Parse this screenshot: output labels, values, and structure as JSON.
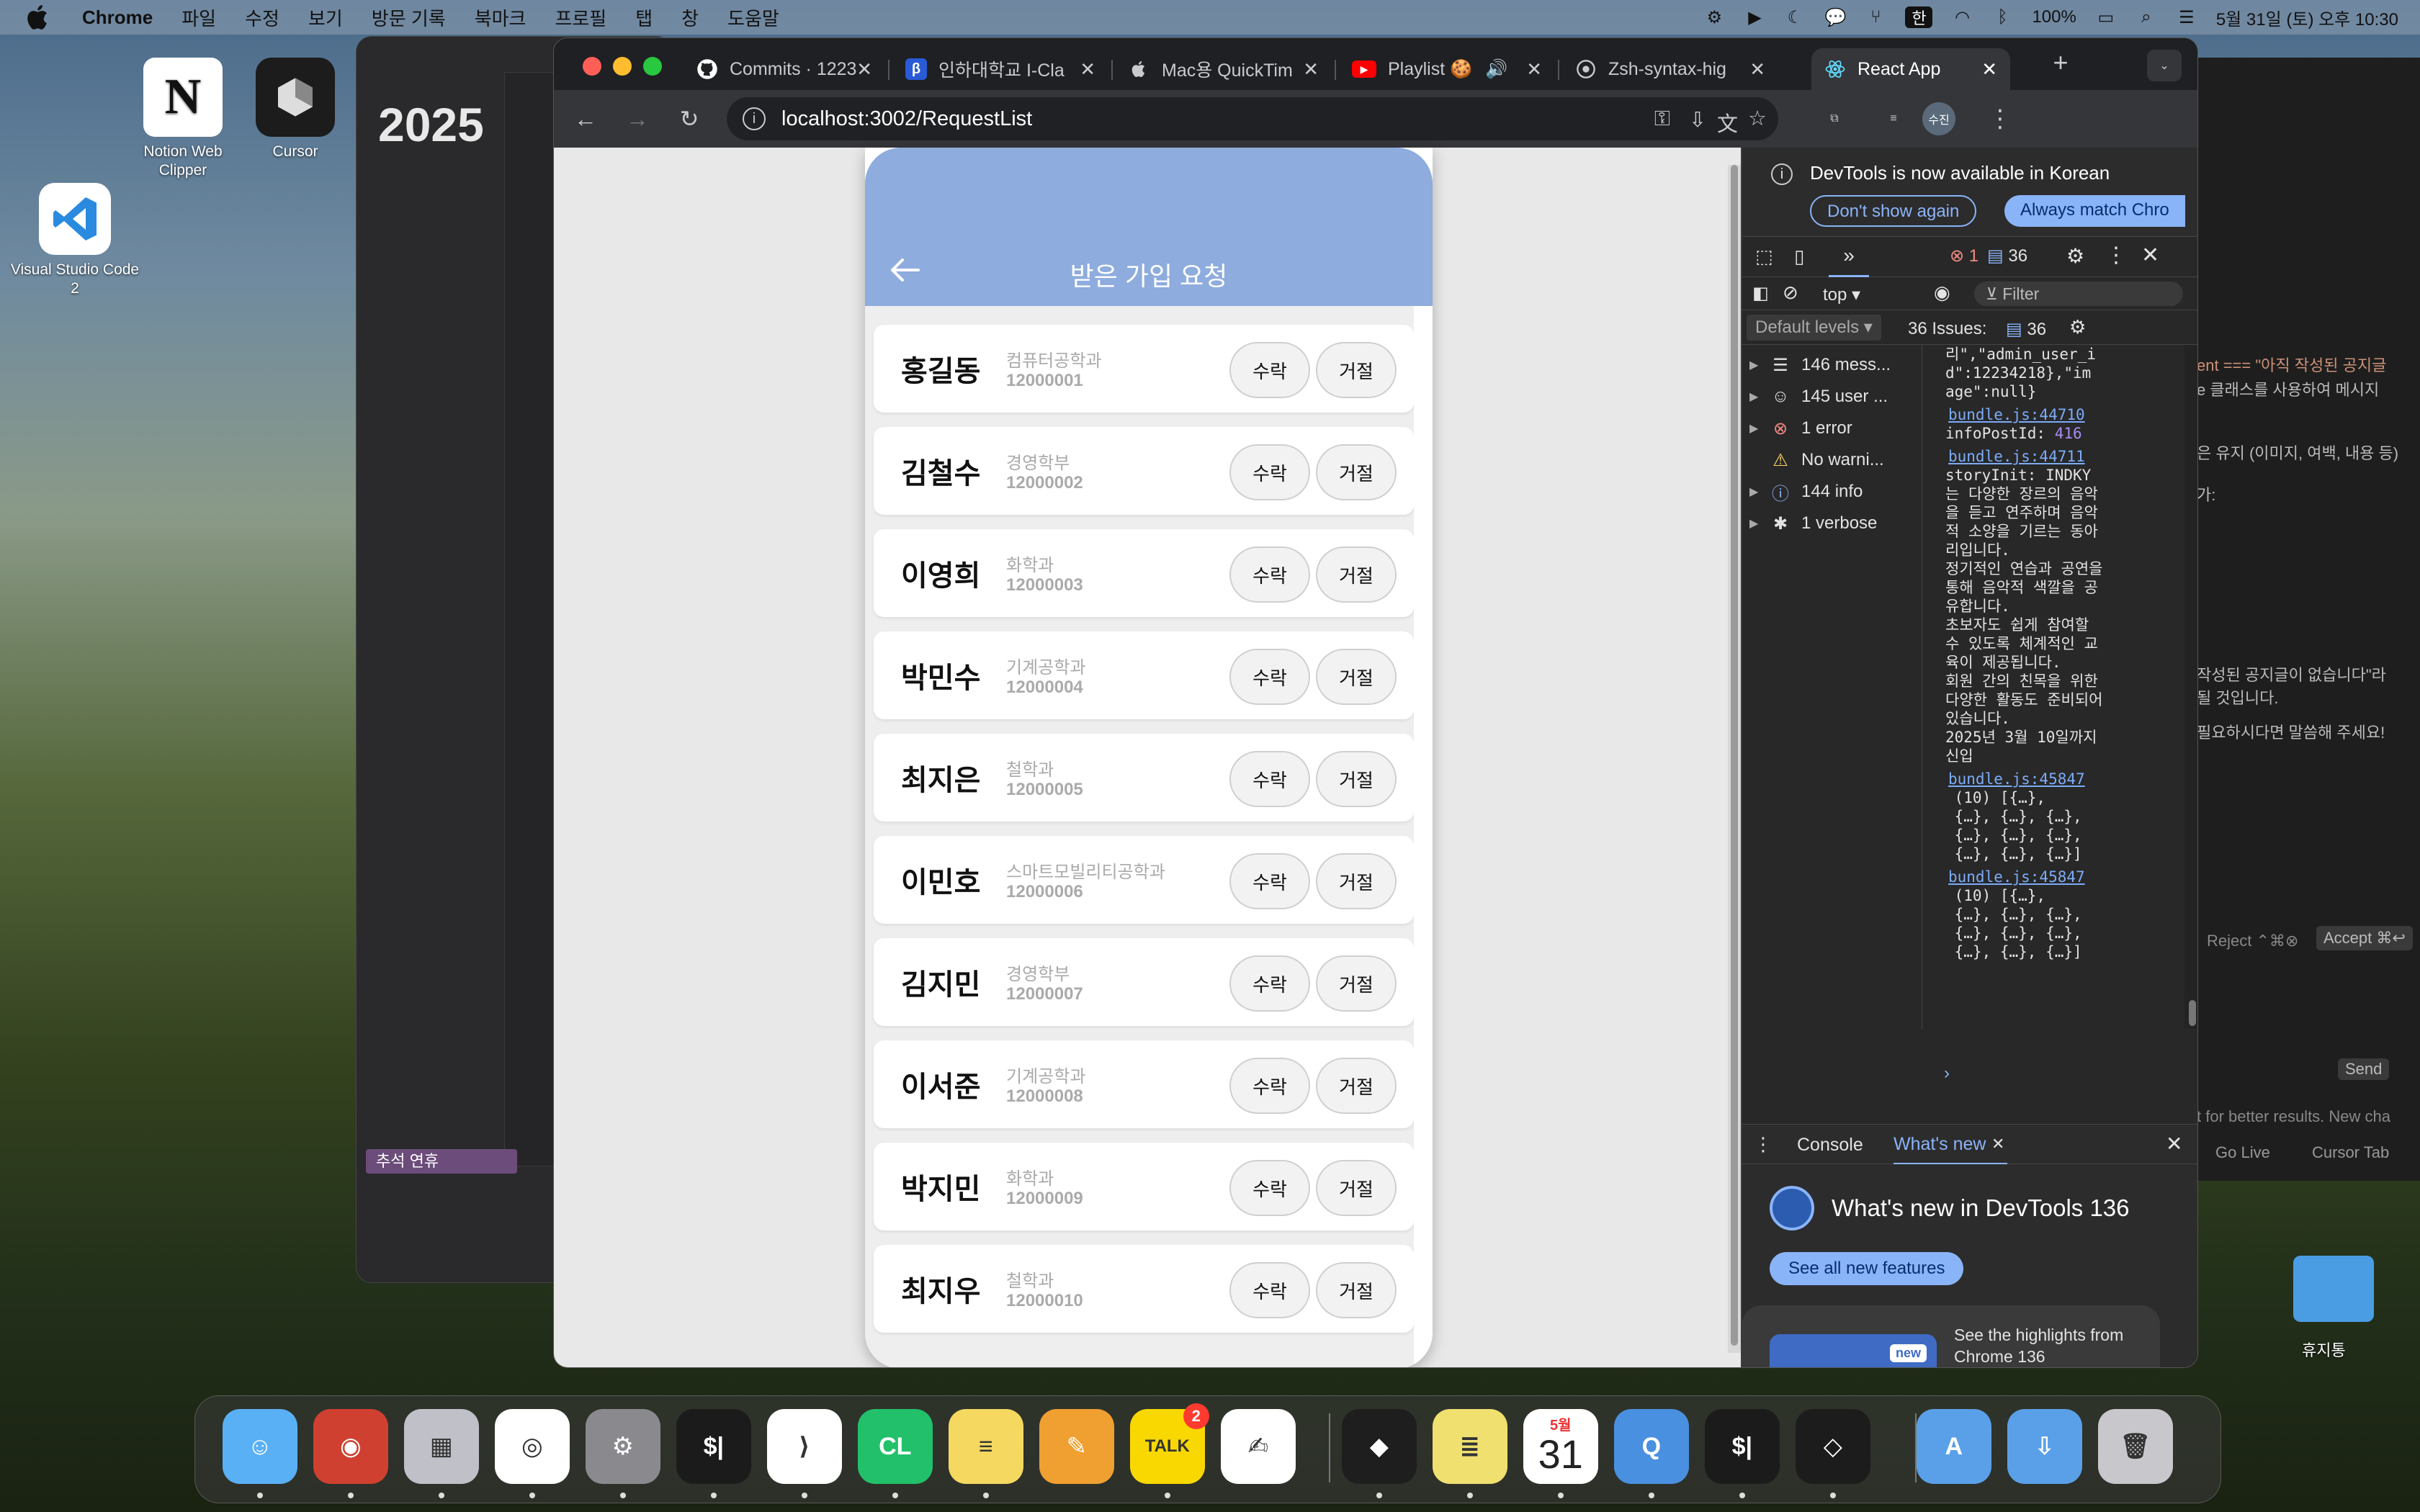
{
  "menubar": {
    "app": "Chrome",
    "menus": [
      "파일",
      "수정",
      "보기",
      "방문 기록",
      "북마크",
      "프로필",
      "탭",
      "창",
      "도움말"
    ],
    "battery": "100%",
    "input_lang": "한",
    "clock": "5월 31일 (토) 오후 10:30"
  },
  "desktop": {
    "icons": [
      {
        "label": "Notion Web Clipper",
        "icon": "notion-icon"
      },
      {
        "label": "Cursor",
        "icon": "cursor-icon"
      },
      {
        "label": "Visual Studio Code 2",
        "icon": "vscode-icon"
      }
    ],
    "trash_label": "휴지통"
  },
  "background_windows": {
    "title_fragment": "2025",
    "chip_label": "추석 연휴",
    "editor_lines": [
      "ent === \"아직 작성된 공지글",
      "e 클래스를 사용하여 메시지",
      "은 유지 (이미지, 여백, 내용 등)",
      "가:",
      "작성된 공지글이 없습니다\"라",
      "될 것입니다.",
      "필요하시다면 말씀해 주세요!",
      "Reject ⌃⌘⊗",
      "Accept ⌘↩",
      "Send",
      "t for better results.  New cha",
      "Go Live",
      "Cursor Tab"
    ]
  },
  "browser": {
    "tabs": [
      {
        "label": "Commits · 1223",
        "icon": "github-icon",
        "active": false
      },
      {
        "label": "인하대학교 I-Cla",
        "icon": "inha-icon",
        "active": false
      },
      {
        "label": "Mac용 QuickTim",
        "icon": "apple-icon",
        "active": false
      },
      {
        "label": "Playlist 🍪",
        "icon": "youtube-icon",
        "active": false
      },
      {
        "label": "Zsh-syntax-hig",
        "icon": "web-icon",
        "active": false
      },
      {
        "label": "React App",
        "icon": "react-icon",
        "active": true
      }
    ],
    "url": "localhost:3002/RequestList",
    "profile_badge": "수진"
  },
  "app": {
    "title": "받은 가입 요청",
    "accept_label": "수락",
    "reject_label": "거절",
    "requests": [
      {
        "name": "홍길동",
        "dept": "컴퓨터공학과",
        "id": "12000001"
      },
      {
        "name": "김철수",
        "dept": "경영학부",
        "id": "12000002"
      },
      {
        "name": "이영희",
        "dept": "화학과",
        "id": "12000003"
      },
      {
        "name": "박민수",
        "dept": "기계공학과",
        "id": "12000004"
      },
      {
        "name": "최지은",
        "dept": "철학과",
        "id": "12000005"
      },
      {
        "name": "이민호",
        "dept": "스마트모빌리티공학과",
        "id": "12000006"
      },
      {
        "name": "김지민",
        "dept": "경영학부",
        "id": "12000007"
      },
      {
        "name": "이서준",
        "dept": "기계공학과",
        "id": "12000008"
      },
      {
        "name": "박지민",
        "dept": "화학과",
        "id": "12000009"
      },
      {
        "name": "최지우",
        "dept": "철학과",
        "id": "12000010"
      }
    ]
  },
  "devtools": {
    "info_message": "DevTools is now available in Korean",
    "dont_show": "Don't show again",
    "always_match": "Always match Chro",
    "error_count": "1",
    "message_count": "36",
    "context": "top",
    "filter_placeholder": "Filter",
    "levels": "Default levels",
    "issues_label": "36 Issues:",
    "issues_count": "36",
    "sidebar": [
      {
        "label": "146 mess...",
        "icon": "list-icon"
      },
      {
        "label": "145 user ...",
        "icon": "user-icon"
      },
      {
        "label": "1 error",
        "icon": "error-icon"
      },
      {
        "label": "No warni...",
        "icon": "warning-icon"
      },
      {
        "label": "144 info",
        "icon": "info-icon"
      },
      {
        "label": "1 verbose",
        "icon": "bug-icon"
      }
    ],
    "console_lines": [
      {
        "t": "리\",\"admin_user_i",
        "k": "txt"
      },
      {
        "t": "d\":12234218},\"im",
        "k": "txt"
      },
      {
        "t": "age\":null}",
        "k": "txt"
      },
      {
        "t": "bundle.js:44710",
        "k": "link"
      },
      {
        "t": "infoPostId: 416",
        "k": "num"
      },
      {
        "t": "bundle.js:44711",
        "k": "link"
      },
      {
        "t": "storyInit: INDKY",
        "k": "txt"
      },
      {
        "t": "는 다양한 장르의 음악",
        "k": "txt"
      },
      {
        "t": "을 듣고 연주하며 음악",
        "k": "txt"
      },
      {
        "t": "적 소양을 기르는 동아",
        "k": "txt"
      },
      {
        "t": "리입니다.",
        "k": "txt"
      },
      {
        "t": "정기적인 연습과 공연을",
        "k": "txt"
      },
      {
        "t": "통해 음악적 색깔을 공",
        "k": "txt"
      },
      {
        "t": "유합니다.",
        "k": "txt"
      },
      {
        "t": "초보자도 쉽게 참여할",
        "k": "txt"
      },
      {
        "t": "수 있도록 체계적인 교",
        "k": "txt"
      },
      {
        "t": "육이 제공됩니다.",
        "k": "txt"
      },
      {
        "t": "회원 간의 친목을 위한",
        "k": "txt"
      },
      {
        "t": "다양한 활동도 준비되어",
        "k": "txt"
      },
      {
        "t": "있습니다.",
        "k": "txt"
      },
      {
        "t": "2025년 3월 10일까지",
        "k": "txt"
      },
      {
        "t": "신입",
        "k": "txt"
      },
      {
        "t": "bundle.js:45847",
        "k": "link"
      },
      {
        "t": " (10) [{…},",
        "k": "txt"
      },
      {
        "t": " {…}, {…}, {…},",
        "k": "txt"
      },
      {
        "t": " {…}, {…}, {…},",
        "k": "txt"
      },
      {
        "t": " {…}, {…}, {…}]",
        "k": "txt"
      },
      {
        "t": "bundle.js:45847",
        "k": "link"
      },
      {
        "t": " (10) [{…},",
        "k": "txt"
      },
      {
        "t": " {…}, {…}, {…},",
        "k": "txt"
      },
      {
        "t": " {…}, {…}, {…},",
        "k": "txt"
      },
      {
        "t": " {…}, {…}, {…}]",
        "k": "txt"
      }
    ],
    "drawer_console": "Console",
    "drawer_whatsnew": "What's new",
    "whatsnew_title": "What's new in DevTools 136",
    "see_all": "See all new features",
    "highlight_badge": "new",
    "highlight_text": "See the highlights from Chrome 136"
  },
  "dock": {
    "apps": [
      "Finder",
      "Photo Booth",
      "Launchpad",
      "Chrome",
      "System Settings",
      "Terminal",
      "VS Code",
      "CLion",
      "Notes",
      "Pages",
      "KakaoTalk",
      "TextEdit",
      "Figma",
      "Stickies",
      "Calendar",
      "QuickTime",
      "iTerm",
      "Cursor",
      "Applications",
      "Downloads",
      "Trash"
    ],
    "kakao_badge": "2",
    "calendar_month": "5월",
    "calendar_day": "31"
  }
}
